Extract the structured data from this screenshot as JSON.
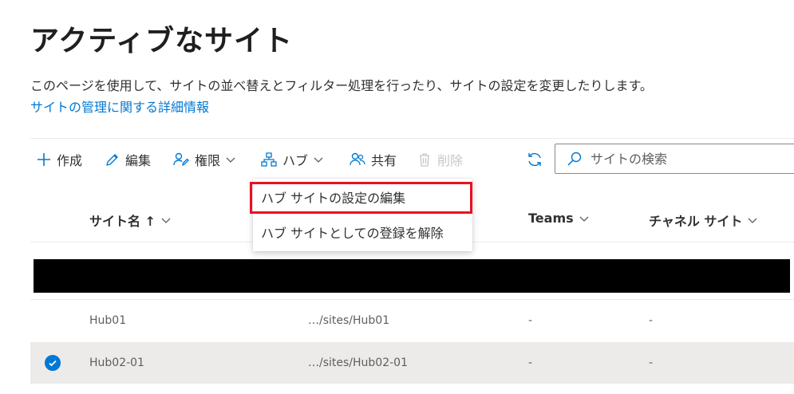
{
  "page": {
    "title": "アクティブなサイト",
    "description": "このページを使用して、サイトの並べ替えとフィルター処理を行ったり、サイトの設定を変更したりします。",
    "more_link": "サイトの管理に関する詳細情報"
  },
  "toolbar": {
    "create": "作成",
    "edit": "編集",
    "permissions": "権限",
    "hub": "ハブ",
    "share": "共有",
    "delete": "削除"
  },
  "search": {
    "placeholder": "サイトの検索"
  },
  "hub_menu": {
    "items": [
      "ハブ サイトの設定の編集",
      "ハブ サイトとしての登録を解除"
    ]
  },
  "table": {
    "columns": [
      "サイト名 ↑",
      "Teams",
      "チャネル サイト"
    ],
    "rows": [
      {
        "name": "Hub01",
        "url": "…/sites/Hub01",
        "teams": "-",
        "channel": "-",
        "selected": false
      },
      {
        "name": "Hub02-01",
        "url": "…/sites/Hub02-01",
        "teams": "-",
        "channel": "-",
        "selected": true
      }
    ]
  },
  "colors": {
    "accent": "#0078d4",
    "highlight_border": "#e81123",
    "selected_row": "#edebe9"
  },
  "icons": [
    "plus-icon",
    "pencil-icon",
    "people-permission-icon",
    "chevron-down-icon",
    "hub-org-icon",
    "share-people-icon",
    "trash-icon",
    "refresh-icon",
    "search-icon",
    "checkmark-icon"
  ]
}
